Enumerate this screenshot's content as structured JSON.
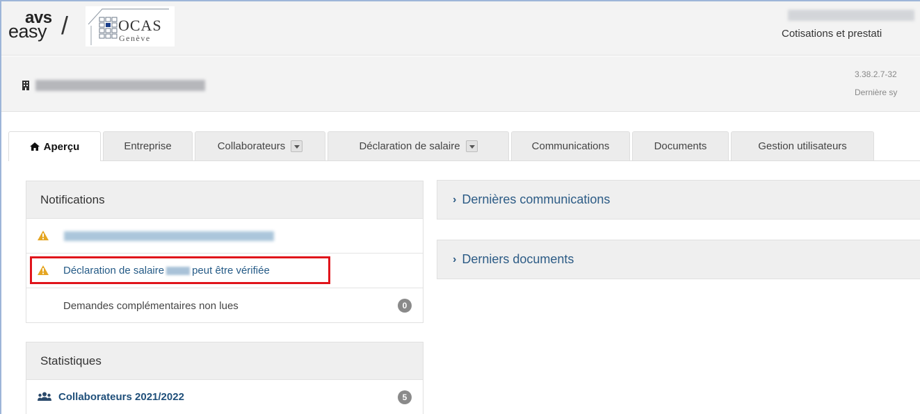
{
  "header": {
    "logo_avs": "avs",
    "logo_easy": "easy",
    "logo_slash": "/",
    "ocas_name": "OCAS",
    "ocas_city": "Genève",
    "right_text": "Cotisations et prestati"
  },
  "company": {
    "version": "3.38.2.7-32",
    "sync": "Dernière sy"
  },
  "tabs": [
    {
      "label": "Aperçu",
      "icon": "home-icon",
      "active": true
    },
    {
      "label": "Entreprise"
    },
    {
      "label": "Collaborateurs",
      "dropdown": true
    },
    {
      "label": "Déclaration de salaire",
      "dropdown": true
    },
    {
      "label": "Communications"
    },
    {
      "label": "Documents"
    },
    {
      "label": "Gestion utilisateurs"
    }
  ],
  "notifications": {
    "title": "Notifications",
    "items": [
      {
        "icon": "warning-icon"
      },
      {
        "icon": "warning-icon",
        "text_before": "Déclaration de salaire",
        "text_after": "peut être vérifiée"
      },
      {
        "label": "Demandes complémentaires non lues",
        "count": "0"
      }
    ]
  },
  "statistics": {
    "title": "Statistiques",
    "items": [
      {
        "icon": "users-icon",
        "label": "Collaborateurs 2021/2022",
        "count": "5"
      }
    ]
  },
  "right_panels": {
    "communications": "Dernières communications",
    "documents": "Derniers documents"
  },
  "colors": {
    "link": "#245a86",
    "warning": "#e5a623",
    "highlight": "#e0141b"
  }
}
